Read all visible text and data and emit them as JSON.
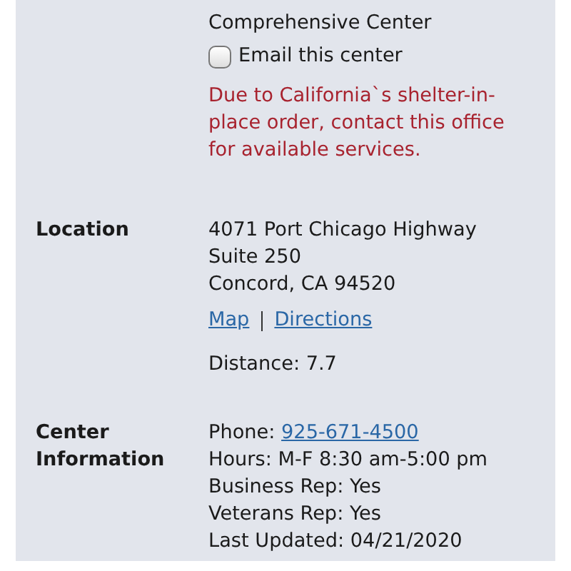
{
  "intro": {
    "center_type": "Comprehensive Center",
    "email_checkbox": {
      "label": "Email this center",
      "checked": false
    },
    "notice": "Due to California`s shelter-in-place order, contact this office for available services."
  },
  "sections": [
    {
      "label": "Location",
      "items": [
        {
          "kind": "text",
          "text": "4071 Port Chicago Highway"
        },
        {
          "kind": "text",
          "text": "Suite 250"
        },
        {
          "kind": "text",
          "text": "Concord, CA 94520"
        },
        {
          "kind": "links",
          "links": [
            "Map",
            "Directions"
          ]
        },
        {
          "kind": "spaced_text",
          "text": "Distance: 7.7"
        }
      ]
    },
    {
      "label": "Center Information",
      "items": [
        {
          "kind": "labeled_link",
          "label": "Phone:",
          "link": "925-671-4500"
        },
        {
          "kind": "text",
          "text": "Hours: M-F 8:30 am-5:00 pm"
        },
        {
          "kind": "text",
          "text": "Business Rep: Yes"
        },
        {
          "kind": "text",
          "text": "Veterans Rep: Yes"
        },
        {
          "kind": "text",
          "text": "Last Updated: 04/21/2020"
        }
      ]
    }
  ]
}
